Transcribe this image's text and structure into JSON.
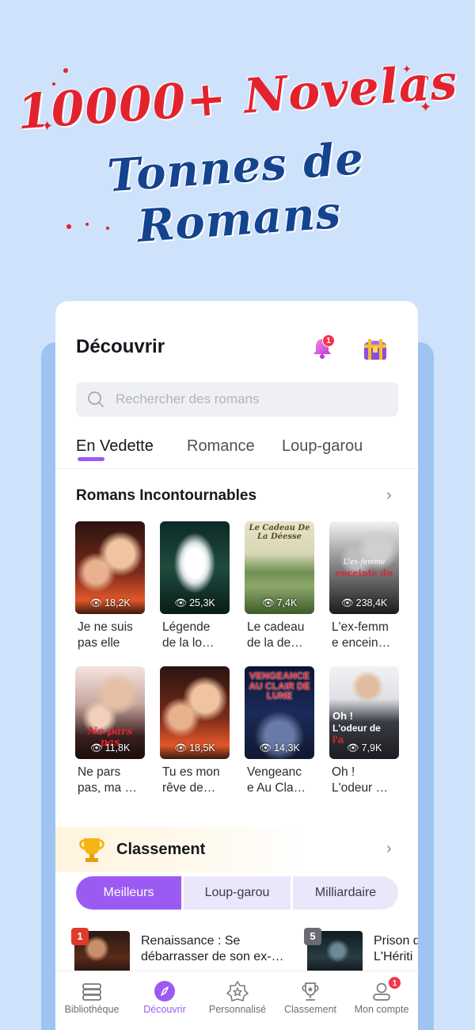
{
  "promo": {
    "line1": "10000+ Novelas",
    "line2": "Tonnes de Romans"
  },
  "header": {
    "title": "Découvrir",
    "notification_count": "1"
  },
  "search": {
    "placeholder": "Rechercher des romans"
  },
  "tabs": [
    {
      "label": "En Vedette",
      "active": true
    },
    {
      "label": "Romance",
      "active": false
    },
    {
      "label": "Loup-garou",
      "active": false
    }
  ],
  "must_read": {
    "title": "Romans Incontournables",
    "books": [
      {
        "title_line1": "Je ne suis",
        "title_line2": "pas elle",
        "views": "18,2K"
      },
      {
        "title_line1": "Légende",
        "title_line2": "de la lo…",
        "views": "25,3K"
      },
      {
        "title_line1": "Le cadeau",
        "title_line2": "de la de…",
        "views": "7,4K"
      },
      {
        "title_line1": "L'ex-femm",
        "title_line2": "e encein…",
        "views": "238,4K"
      },
      {
        "title_line1": "Ne pars",
        "title_line2": "pas, ma …",
        "views": "11,8K"
      },
      {
        "title_line1": "Tu es mon",
        "title_line2": "rêve de…",
        "views": "18,5K"
      },
      {
        "title_line1": "Vengeanc",
        "title_line2": "e Au Cla…",
        "views": "14,3K"
      },
      {
        "title_line1": "Oh !",
        "title_line2": "L'odeur …",
        "views": "7,9K"
      }
    ],
    "cover_texts": {
      "book3": "Le Cadeau De La Déesse",
      "book4_a": "L'ex-femme",
      "book4_b": "enceinte du",
      "book5": "Ne pars pas",
      "book7": "VENGEANCE AU CLAIR DE LUNE",
      "book8_a": "Oh !",
      "book8_b": "L'odeur de",
      "book8_c": "l'a"
    }
  },
  "ranking": {
    "title": "Classement",
    "tabs": [
      {
        "label": "Meilleurs",
        "active": true
      },
      {
        "label": "Loup-garou",
        "active": false
      },
      {
        "label": "Milliardaire",
        "active": false
      }
    ],
    "items": [
      {
        "rank": "1",
        "line1": "Renaissance : Se",
        "line2": "débarrasser de son ex-…"
      },
      {
        "rank": "5",
        "line1": "Prison d",
        "line2": "L'Hériti"
      }
    ]
  },
  "bottom_nav": [
    {
      "label": "Bibliothèque",
      "icon": "books-icon"
    },
    {
      "label": "Découvrir",
      "icon": "compass-icon",
      "active": true
    },
    {
      "label": "Personnalisé",
      "icon": "star-badge-icon"
    },
    {
      "label": "Classement",
      "icon": "trophy-icon"
    },
    {
      "label": "Mon compte",
      "icon": "user-icon",
      "badge": "1"
    }
  ],
  "colors": {
    "accent": "#9b5bf2",
    "background": "#cfe2fb",
    "promo_red": "#e2232e",
    "promo_blue": "#14438f",
    "badge_red": "#f5334d"
  }
}
